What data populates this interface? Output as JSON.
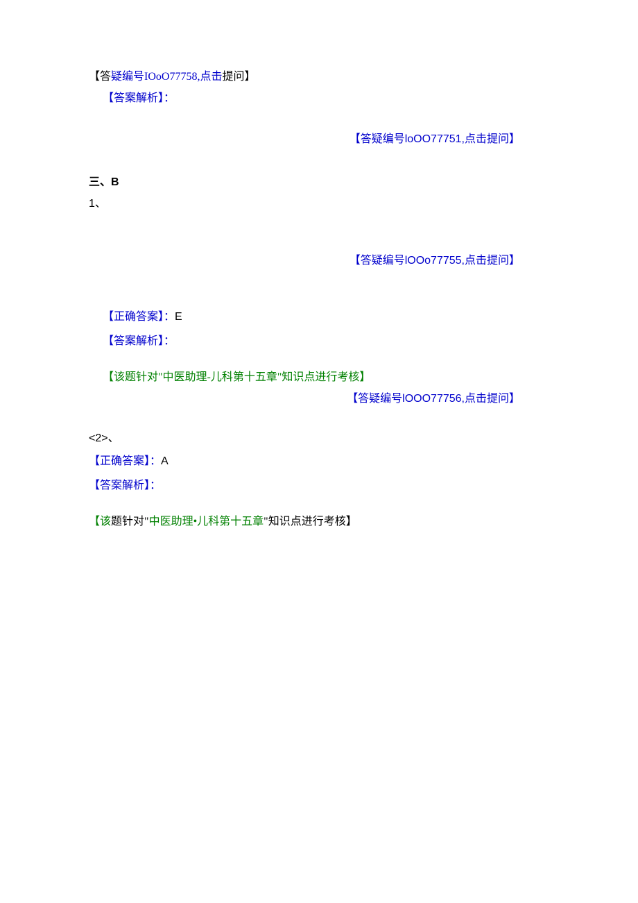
{
  "line1": {
    "prefix_black": "【答",
    "middle_blue": "疑编号IOoO77758,点击",
    "suffix_black": "提问】"
  },
  "line2": "【答案解析】：",
  "rightLink1": {
    "prefix": "【答疑编号",
    "id": "loOO77751,",
    "suffix": "点击提问】"
  },
  "sectionHeading": {
    "part1": "三、",
    "part2": "B"
  },
  "itemNum1": "1、",
  "rightLink2": {
    "prefix": "【答疑编号",
    "id": "lOOo77755,",
    "suffix": "点击提问】"
  },
  "answer1": {
    "label": "【正确答案】：",
    "value": "E"
  },
  "analysis1": "【答案解析】：",
  "note1": {
    "pre": "【该题针对\"中医助理-儿科第十五章\"知识点进行考核】"
  },
  "rightLink3": {
    "prefix": "【答疑编号",
    "id": "lOOO77756,",
    "suffix": "点击提问】"
  },
  "itemNum2": {
    "part1": "<2>",
    "part2": "、"
  },
  "answer2": {
    "label": "【正确答案】：",
    "value": "A"
  },
  "analysis2": "【答案解析】：",
  "note2": {
    "t1": "【该",
    "t2": "题针对\"",
    "t3": "中医助理•儿科第十五章",
    "t4": "\"知识点进行考核】"
  }
}
